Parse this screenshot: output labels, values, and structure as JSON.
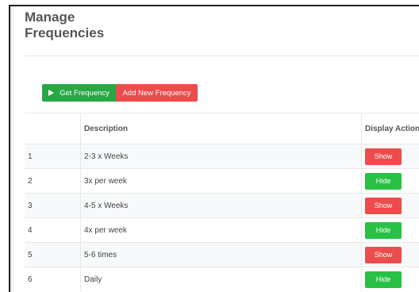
{
  "page": {
    "title": "Manage Frequencies"
  },
  "toolbar": {
    "get_label": "Get Frequency",
    "add_label": "Add New Frequency"
  },
  "table": {
    "headers": [
      "",
      "Description",
      "Display Action"
    ],
    "rows": [
      {
        "num": "1",
        "description": "2-3 x Weeks",
        "action": "Show"
      },
      {
        "num": "2",
        "description": "3x per week",
        "action": "Hide"
      },
      {
        "num": "3",
        "description": "4-5 x Weeks",
        "action": "Show"
      },
      {
        "num": "4",
        "description": "4x per week",
        "action": "Hide"
      },
      {
        "num": "5",
        "description": "5-6 times",
        "action": "Show"
      },
      {
        "num": "6",
        "description": "Daily",
        "action": "Hide"
      }
    ]
  },
  "colors": {
    "show": "#ec4c4c",
    "hide": "#28c045",
    "primary": "#28a745"
  },
  "icons": {
    "get_button": "play-icon"
  }
}
